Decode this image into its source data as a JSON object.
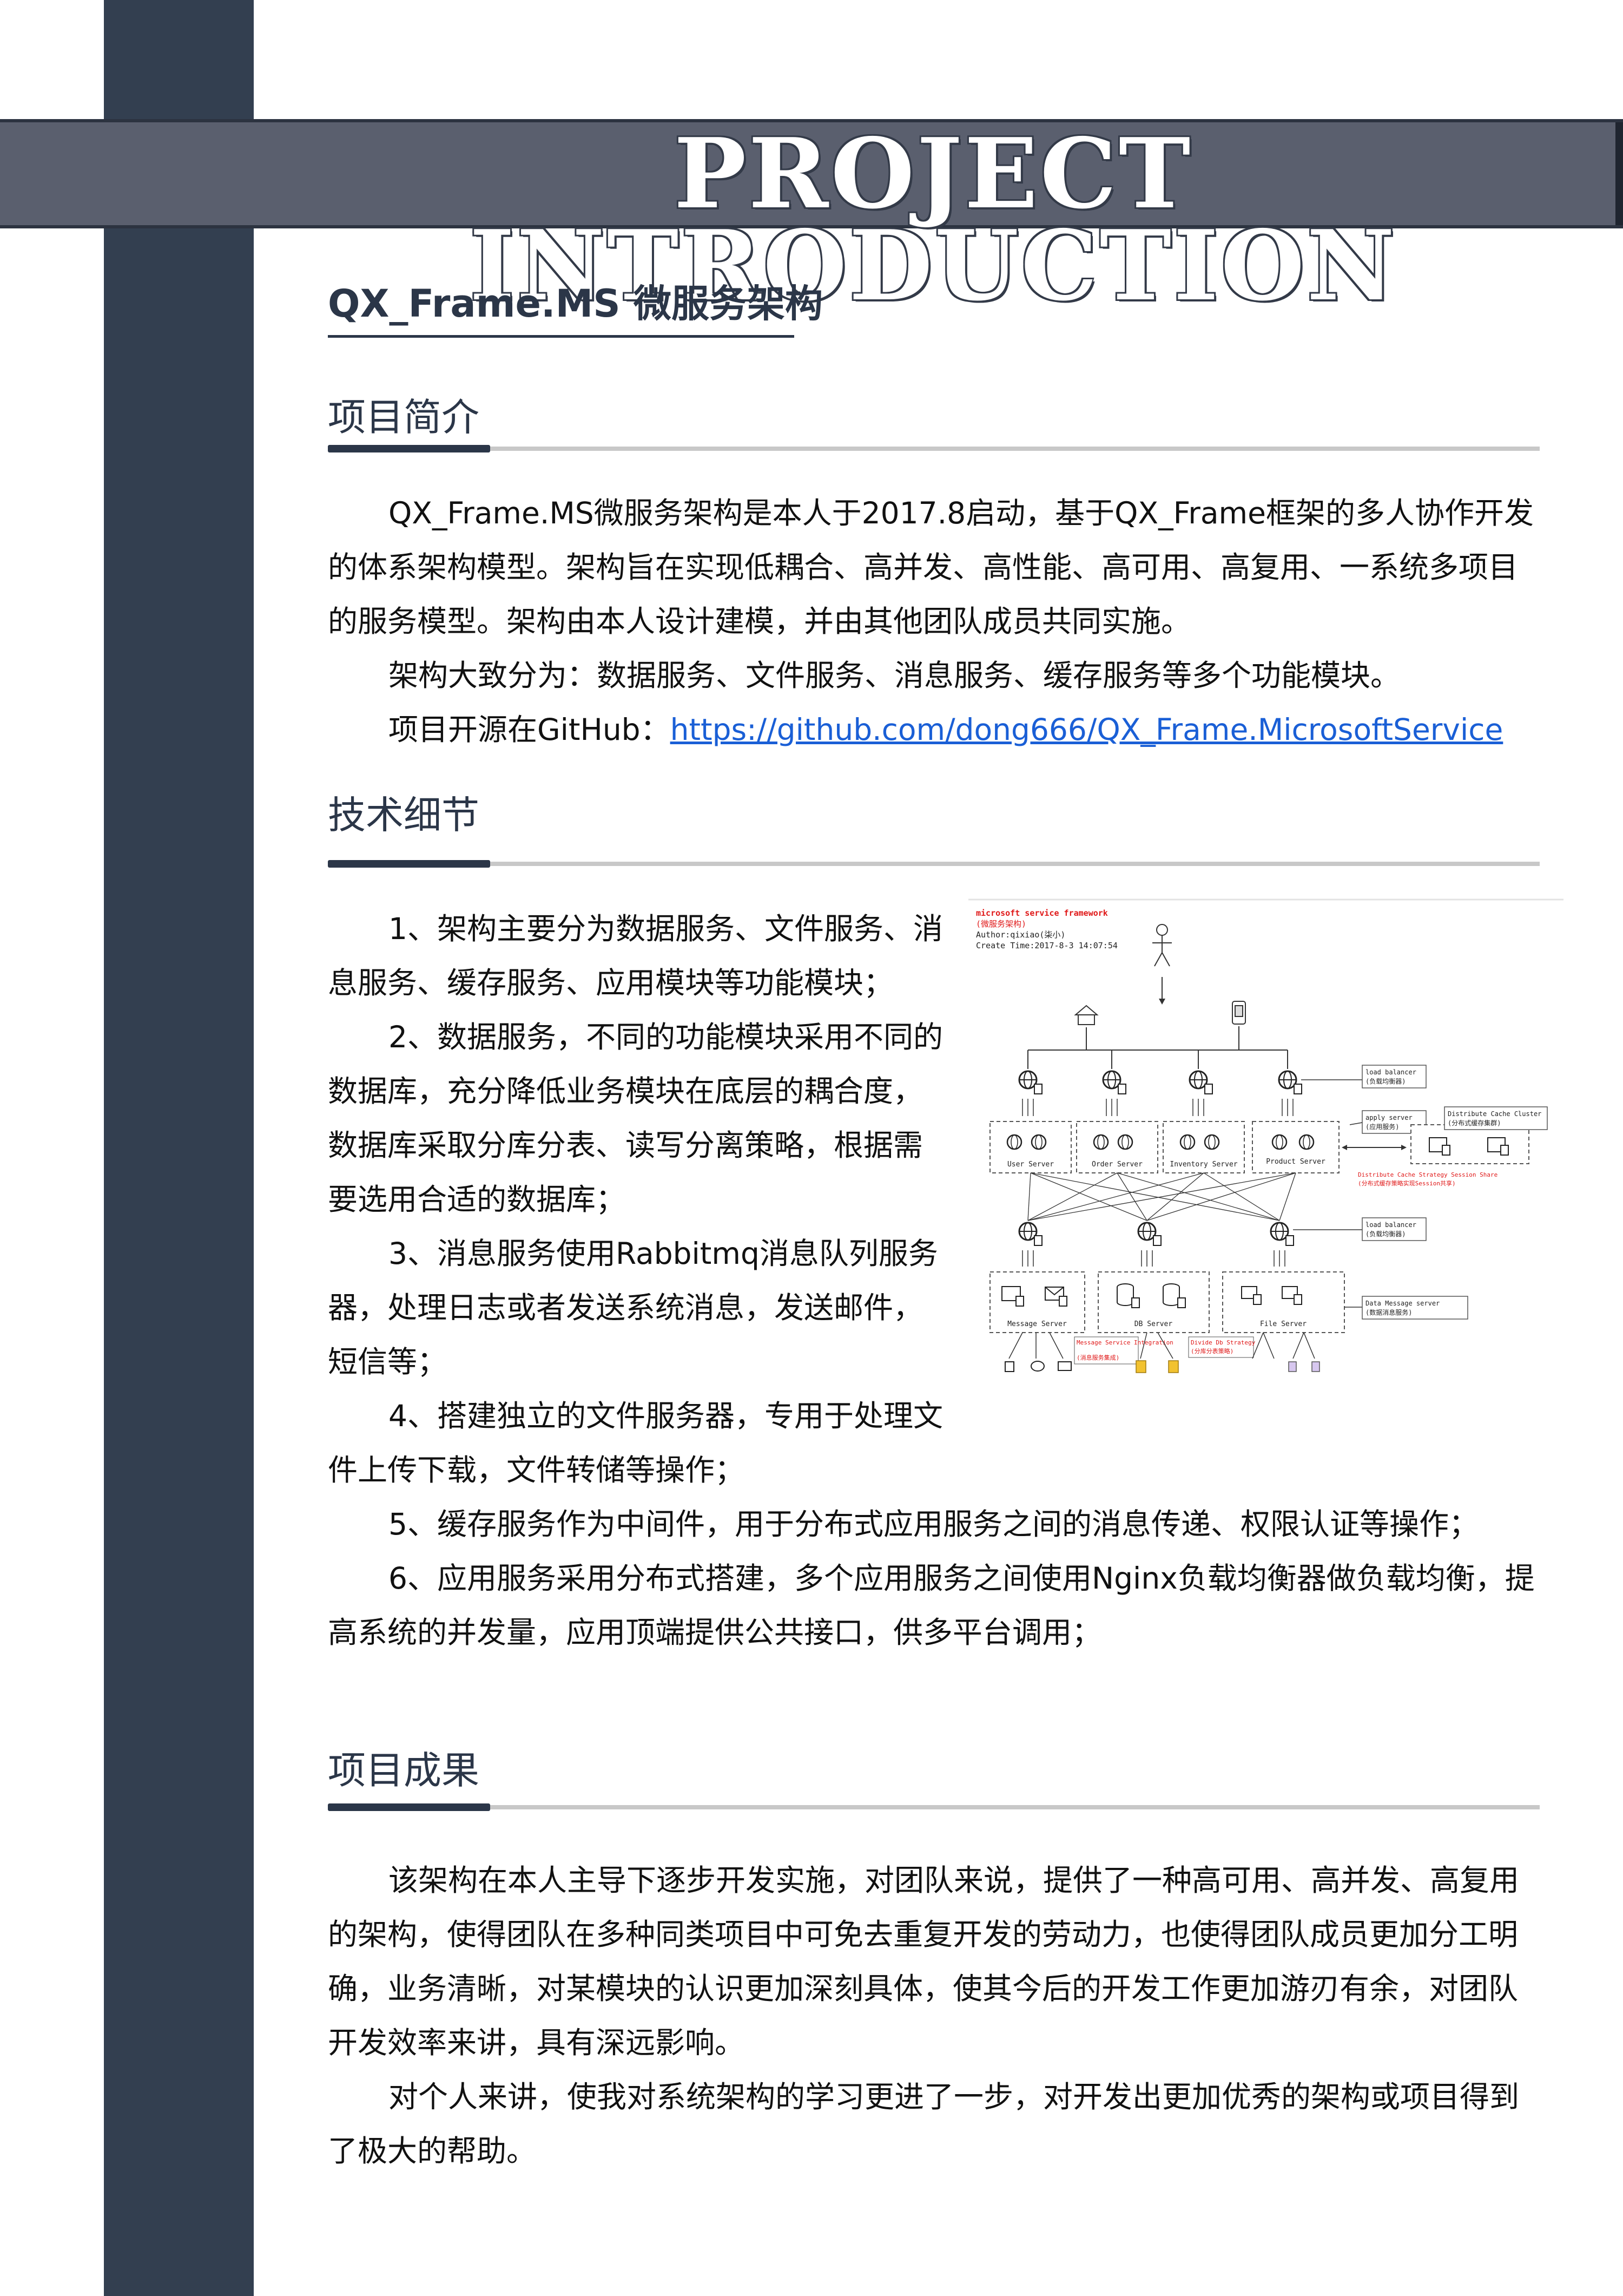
{
  "banner": {
    "title": "PROJECT INTRODUCTION"
  },
  "subtitle": "QX_Frame.MS 微服务架构",
  "intro": {
    "heading": "项目简介",
    "p1": "QX_Frame.MS微服务架构是本人于2017.8启动，基于QX_Frame框架的多人协作开发的体系架构模型。架构旨在实现低耦合、高并发、高性能、高可用、高复用、一系统多项目的服务模型。架构由本人设计建模，并由其他团队成员共同实施。",
    "p2": "架构大致分为：数据服务、文件服务、消息服务、缓存服务等多个功能模块。",
    "p3_prefix": "项目开源在GitHub：",
    "p3_link": "https://github.com/dong666/QX_Frame.MicrosoftService"
  },
  "tech": {
    "heading": "技术细节",
    "items": [
      "1、架构主要分为数据服务、文件服务、消息服务、缓存服务、应用模块等功能模块；",
      "2、数据服务，不同的功能模块采用不同的数据库，充分降低业务模块在底层的耦合度，数据库采取分库分表、读写分离策略，根据需要选用合适的数据库；",
      "3、消息服务使用Rabbitmq消息队列服务器，处理日志或者发送系统消息，发送邮件，短信等；",
      "4、搭建独立的文件服务器，专用于处理文件上传下载，文件转储等操作；",
      "5、缓存服务作为中间件，用于分布式应用服务之间的消息传递、权限认证等操作；",
      "6、应用服务采用分布式搭建，多个应用服务之间使用Nginx负载均衡器做负载均衡，提高系统的并发量，应用顶端提供公共接口，供多平台调用；"
    ]
  },
  "diagram": {
    "title_en": "microsoft service framework",
    "title_cn": "(微服务架构)",
    "author": "Author:qixiao(柒小)",
    "created": "Create Time:2017-8-3 14:07:54",
    "load_balancer_1": "load balancer",
    "load_balancer_1_cn": "(负载均衡器)",
    "apply_server": "apply server",
    "apply_server_cn": "(应用服务)",
    "cache_cluster": "Distribute Cache Cluster",
    "cache_cluster_cn": "(分布式缓存集群)",
    "user_server": "User Server",
    "order_server": "Order Server",
    "inventory_server": "Inventory Server",
    "product_server": "Product Server",
    "cache_strategy": "Distribute Cache Strategy Session Share",
    "cache_strategy_cn": "(分布式缓存策略实现Session共享)",
    "load_balancer_2": "load balancer",
    "load_balancer_2_cn": "(负载均衡器)",
    "data_message_server": "Data Message server",
    "data_message_server_cn": "(数据消息服务)",
    "message_server": "Message Server",
    "db_server": "DB Server",
    "file_server": "File Server",
    "msg_integration": "Message Service Integration",
    "msg_integration_cn": "(消息服务集成)",
    "db_strategy": "Divide Db Strategy",
    "db_strategy_cn": "(分库分表策略)",
    "colors": {
      "red": "#e01818",
      "line": "#333333",
      "box": "#555555"
    }
  },
  "results": {
    "heading": "项目成果",
    "p1": "该架构在本人主导下逐步开发实施，对团队来说，提供了一种高可用、高并发、高复用的架构，使得团队在多种同类项目中可免去重复开发的劳动力，也使得团队成员更加分工明确，业务清晰，对某模块的认识更加深刻具体，使其今后的开发工作更加游刃有余，对团队开发效率来讲，具有深远影响。",
    "p2": "对个人来讲，使我对系统架构的学习更进了一步，对开发出更加优秀的架构或项目得到了极大的帮助。"
  }
}
